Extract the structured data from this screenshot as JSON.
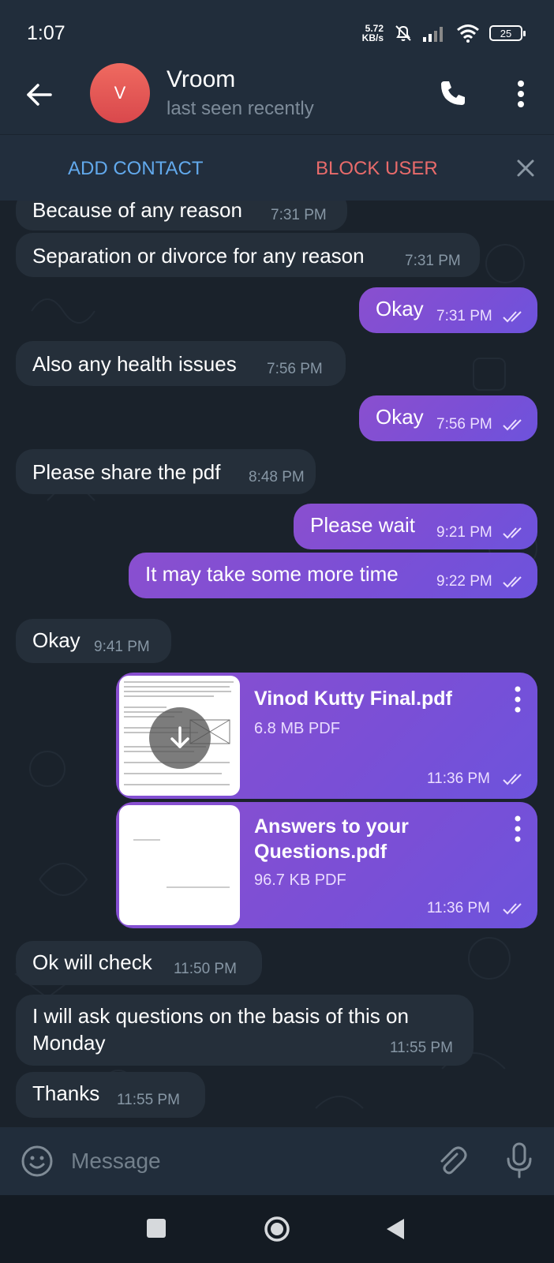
{
  "status_bar": {
    "time": "1:07",
    "net_speed_value": "5.72",
    "net_speed_unit": "KB/s",
    "battery": "25",
    "icons": [
      "mute-bell-icon",
      "signal-icon",
      "wifi-icon",
      "battery-icon"
    ]
  },
  "header": {
    "avatar_letter": "V",
    "name": "Vroom",
    "status": "last seen recently",
    "icons": [
      "back-arrow-icon",
      "phone-icon",
      "more-vertical-icon"
    ]
  },
  "action_bar": {
    "add_contact": "ADD CONTACT",
    "block_user": "BLOCK USER"
  },
  "messages": [
    {
      "dir": "in",
      "text": "Because of any reason",
      "time": "7:31 PM"
    },
    {
      "dir": "in",
      "text": "Separation or divorce for any reason",
      "time": "7:31 PM"
    },
    {
      "dir": "out",
      "text": "Okay",
      "time": "7:31 PM"
    },
    {
      "dir": "in",
      "text": "Also any health issues",
      "time": "7:56 PM"
    },
    {
      "dir": "out",
      "text": "Okay",
      "time": "7:56 PM"
    },
    {
      "dir": "in",
      "text": "Please share the pdf",
      "time": "8:48 PM"
    },
    {
      "dir": "out",
      "text": "Please wait",
      "time": "9:21 PM"
    },
    {
      "dir": "out",
      "text": "It may take some more time",
      "time": "9:22 PM"
    },
    {
      "dir": "in",
      "text": "Okay",
      "time": "9:41 PM"
    },
    {
      "dir": "out",
      "type": "file",
      "name": "Vinod Kutty Final.pdf",
      "size": "6.8 MB PDF",
      "time": "11:36 PM"
    },
    {
      "dir": "out",
      "type": "file",
      "name_line1": "Answers to your",
      "name_line2": "Questions.pdf",
      "size": "96.7 KB PDF",
      "time": "11:36 PM"
    },
    {
      "dir": "in",
      "text": "Ok will check",
      "time": "11:50 PM"
    },
    {
      "dir": "in",
      "text_line1": "I will ask questions on the basis  of this on",
      "text_line2": "Monday",
      "time": "11:55 PM"
    },
    {
      "dir": "in",
      "text": "Thanks",
      "time": "11:55 PM"
    }
  ],
  "composer": {
    "placeholder": "Message",
    "icons": [
      "emoji-icon",
      "attach-icon",
      "mic-icon"
    ]
  },
  "nav_bar": {
    "icons": [
      "recents-square-icon",
      "home-circle-icon",
      "back-triangle-icon"
    ]
  },
  "colors": {
    "header_bg": "#212d3b",
    "chat_bg": "#1a222b",
    "incoming_bubble": "#252f3a",
    "outgoing_bubble": "#7f4fd3",
    "add_contact": "#62a9ec",
    "block_user": "#e96b6b"
  }
}
